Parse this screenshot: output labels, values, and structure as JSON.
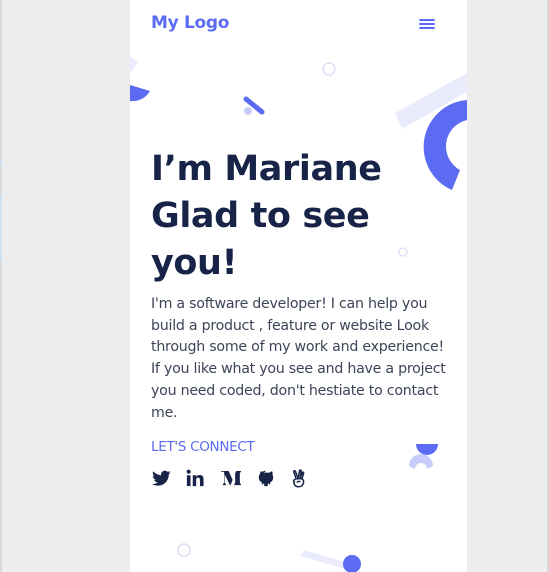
{
  "colors": {
    "accent": "#5b6bf2",
    "text_dark": "#172448",
    "body_text": "#3c4458",
    "light_accent": "#eaecfd"
  },
  "header": {
    "logo": "My Logo",
    "menu_icon": "hamburger-menu-icon"
  },
  "hero": {
    "headline_lines": [
      "I’m Mariane",
      "Glad to see",
      "you!"
    ],
    "intro": "I'm a software developer! I can help you build a product , feature or website Look through some of my work and experience! If you like what you see and have a project you need coded, don't hestiate to contact me.",
    "connect_label": "LET'S CONNECT"
  },
  "socials": [
    {
      "name": "twitter",
      "icon": "twitter-icon"
    },
    {
      "name": "linkedin",
      "icon": "linkedin-icon"
    },
    {
      "name": "medium",
      "icon": "medium-icon"
    },
    {
      "name": "github",
      "icon": "github-icon"
    },
    {
      "name": "angellist",
      "icon": "angellist-icon"
    }
  ]
}
